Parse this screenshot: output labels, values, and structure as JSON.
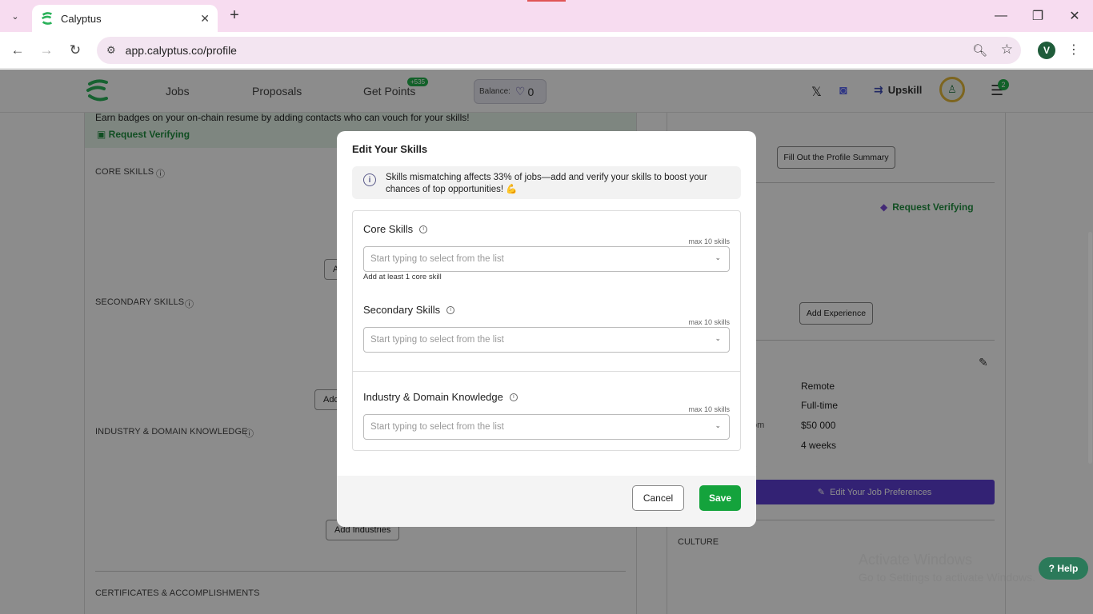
{
  "browser": {
    "tab_title": "Calyptus",
    "url": "app.calyptus.co/profile",
    "profile_initial": "V"
  },
  "header": {
    "nav": [
      "Jobs",
      "Proposals",
      "Get Points"
    ],
    "points_badge": "+535",
    "balance_label": "Balance:",
    "balance_value": "0",
    "upskill": "Upskill",
    "notif_count": "2"
  },
  "left": {
    "banner_text": "Earn badges on your on-chain resume by adding contacts who can vouch for your skills!",
    "request_verifying": "Request Verifying",
    "core_skills": "CORE SKILLS",
    "secondary_skills": "SECONDARY SKILLS",
    "industry": "INDUSTRY & DOMAIN KNOWLEDGE",
    "add_core": "A",
    "add_secondary": "Add",
    "add_industries": "Add Industries",
    "certificates": "CERTIFICATES & ACCOMPLISHMENTS"
  },
  "right": {
    "fill_summary": "Fill Out the Profile Summary",
    "request_verifying": "Request Verifying",
    "add_experience": "Add Experience",
    "section_tail": "s",
    "pref_labels": [
      "om",
      "s"
    ],
    "pref_values": [
      "Remote",
      "Full-time",
      "$50 000",
      "4 weeks"
    ],
    "edit_job": "Edit Your Job Preferences",
    "culture": "CULTURE",
    "help": "Help",
    "watermark_title": "Activate Windows",
    "watermark_sub": "Go to Settings to activate Windows."
  },
  "modal": {
    "title": "Edit Your Skills",
    "info": "Skills mismatching affects 33% of jobs—add and verify your skills to boost your chances of top opportunities! 💪",
    "core_label": "Core Skills",
    "secondary_label": "Secondary Skills",
    "industry_label": "Industry & Domain Knowledge",
    "max": "max 10 skills",
    "placeholder": "Start typing to select from the list",
    "core_hint": "Add at least 1 core skill",
    "cancel": "Cancel",
    "save": "Save"
  }
}
